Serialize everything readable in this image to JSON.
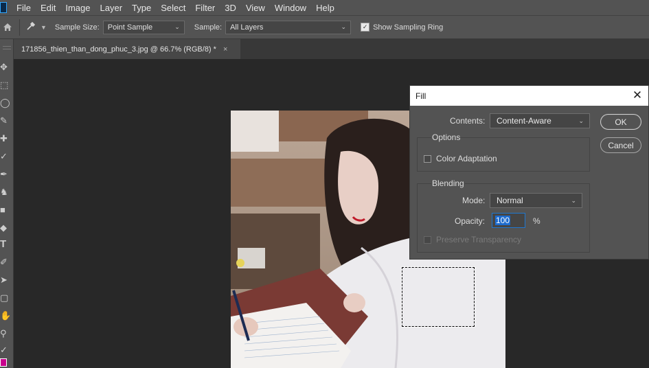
{
  "menubar": {
    "items": [
      "File",
      "Edit",
      "Image",
      "Layer",
      "Type",
      "Select",
      "Filter",
      "3D",
      "View",
      "Window",
      "Help"
    ]
  },
  "options_bar": {
    "home_icon": "home-icon",
    "tool_icon": "eyedropper-icon",
    "sample_size_label": "Sample Size:",
    "sample_size_value": "Point Sample",
    "sample_label": "Sample:",
    "sample_value": "All Layers",
    "show_sampling_ring_label": "Show Sampling Ring",
    "show_sampling_ring_checked": true
  },
  "document_tab": {
    "title": "171856_thien_than_dong_phuc_3.jpg @ 66.7% (RGB/8) *",
    "close_glyph": "×"
  },
  "toolbar": {
    "icons": [
      "move-icon",
      "marquee-icon",
      "lasso-icon",
      "quick-select-icon",
      "crop-icon",
      "eyedropper-icon",
      "brush-icon",
      "stamp-icon",
      "eraser-icon",
      "paint-bucket-icon",
      "type-icon",
      "pen-icon",
      "path-select-icon",
      "shape-icon",
      "hand-icon",
      "zoom-icon",
      "eyedropper-icon",
      "swap-colors-icon"
    ],
    "foreground_color": "#c8008c"
  },
  "fill_dialog": {
    "title": "Fill",
    "contents_label": "Contents:",
    "contents_value": "Content-Aware",
    "options_title": "Options",
    "color_adaptation_label": "Color Adaptation",
    "color_adaptation_checked": false,
    "blending_title": "Blending",
    "mode_label": "Mode:",
    "mode_value": "Normal",
    "opacity_label": "Opacity:",
    "opacity_value": "100",
    "opacity_unit": "%",
    "preserve_transparency_label": "Preserve Transparency",
    "preserve_transparency_checked": false,
    "ok_label": "OK",
    "cancel_label": "Cancel"
  }
}
